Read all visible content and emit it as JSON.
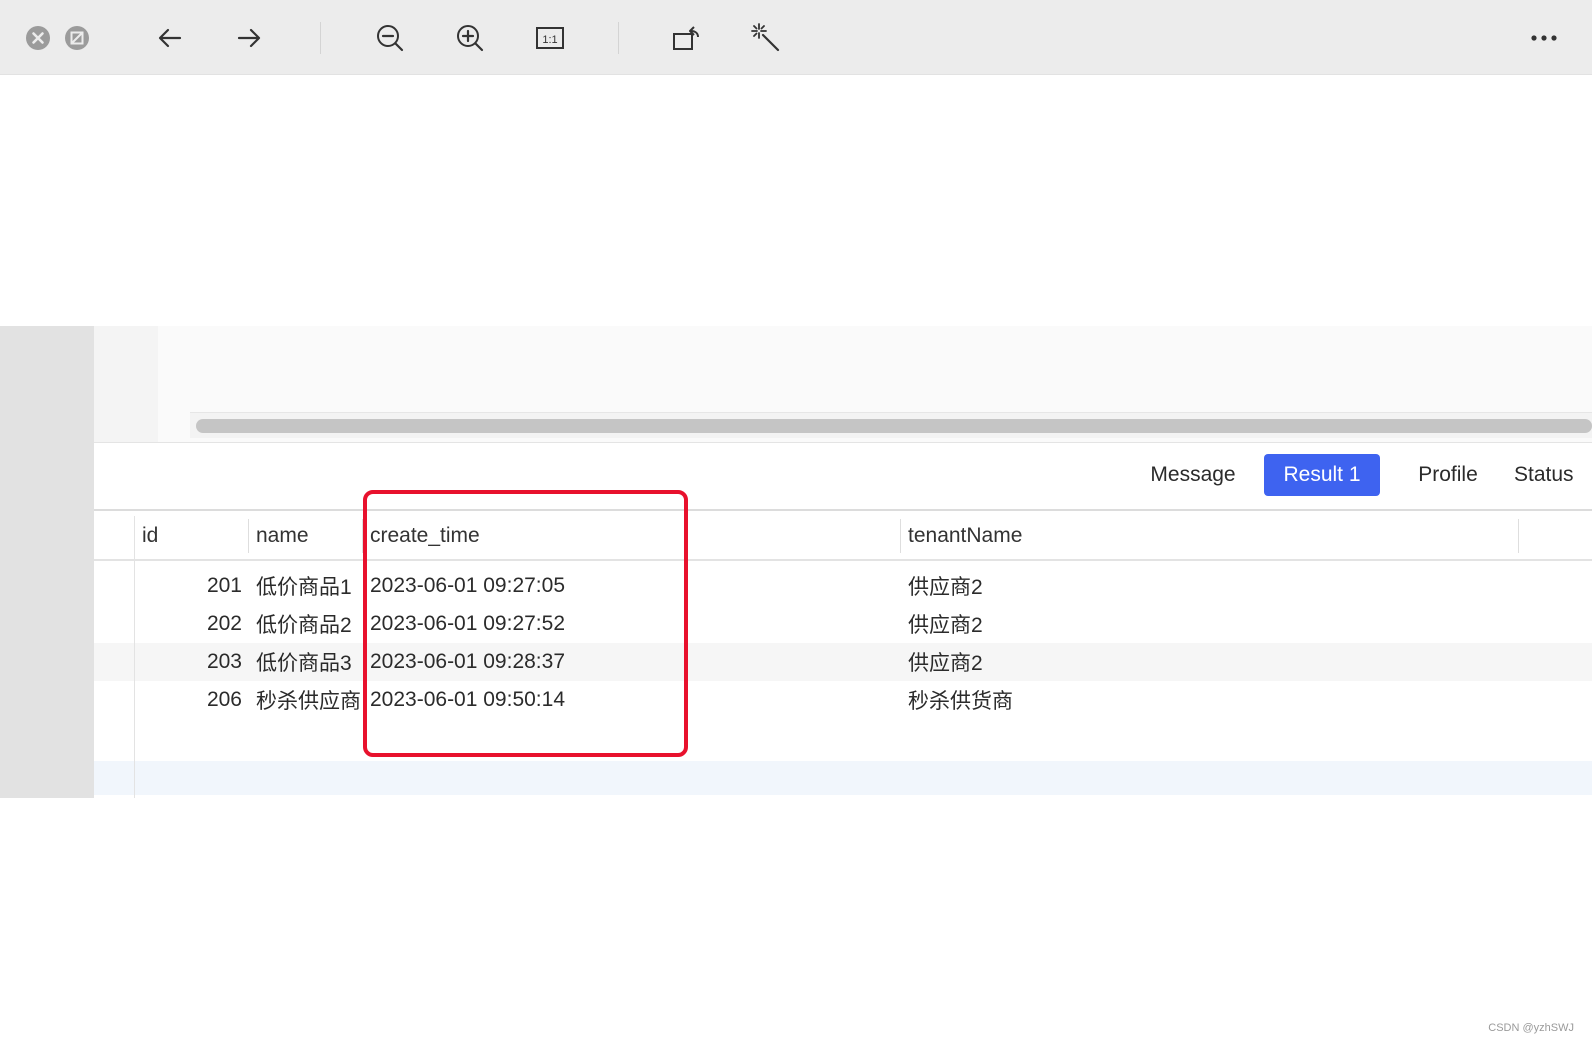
{
  "toolbar": {
    "icons": [
      "close-icon",
      "stop-icon",
      "back-arrow-icon",
      "forward-arrow-icon",
      "zoom-out-icon",
      "zoom-in-icon",
      "actual-size-icon",
      "rotate-icon",
      "magic-wand-icon",
      "more-icon"
    ],
    "actual_size_label": "1:1"
  },
  "tabs": [
    {
      "label": "Message",
      "active": false
    },
    {
      "label": "Result 1",
      "active": true
    },
    {
      "label": "Profile",
      "active": false
    },
    {
      "label": "Status",
      "active": false
    }
  ],
  "grid": {
    "columns": [
      "id",
      "name",
      "create_time",
      "tenantName"
    ],
    "rows": [
      {
        "id": "201",
        "name": "低价商品1",
        "create_time": "2023-06-01 09:27:05",
        "tenantName": "供应商2"
      },
      {
        "id": "202",
        "name": "低价商品2",
        "create_time": "2023-06-01 09:27:52",
        "tenantName": "供应商2"
      },
      {
        "id": "203",
        "name": "低价商品3",
        "create_time": "2023-06-01 09:28:37",
        "tenantName": "供应商2"
      },
      {
        "id": "206",
        "name": "秒杀供应商",
        "create_time": "2023-06-01 09:50:14",
        "tenantName": "秒杀供货商"
      }
    ]
  },
  "colors": {
    "accent": "#3e63f0",
    "highlight": "#e8112d"
  },
  "watermark": "CSDN @yzhSWJ"
}
